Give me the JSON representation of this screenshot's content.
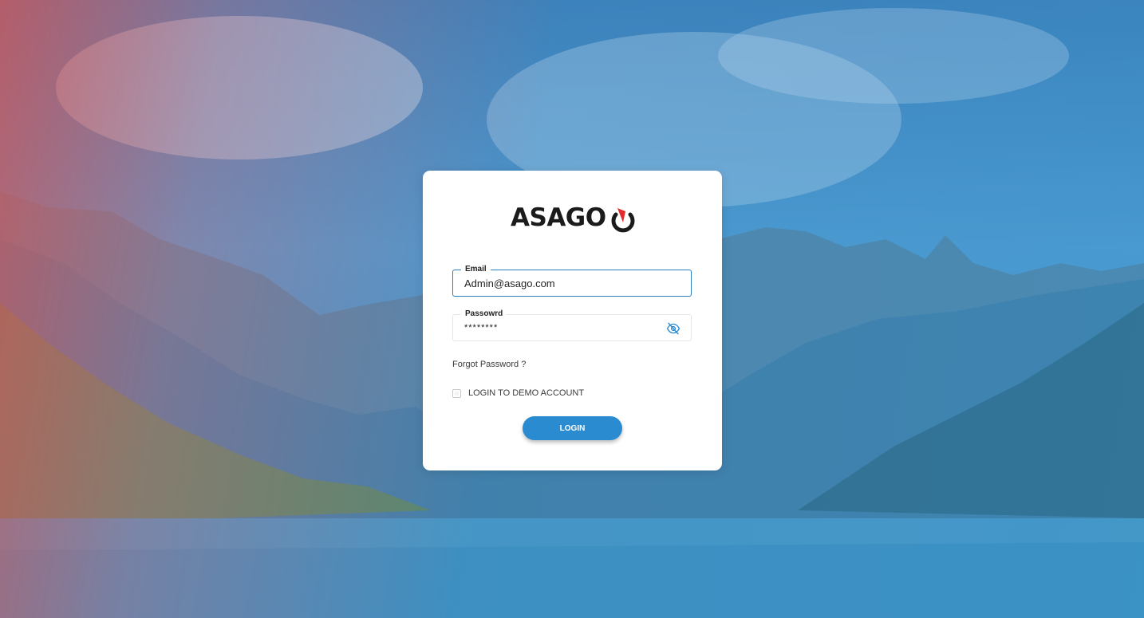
{
  "brand": {
    "logo_text": "ASAGO",
    "logo_icon": "power-timer-icon",
    "accent_color": "#e52b2b"
  },
  "form": {
    "email": {
      "label": "Email",
      "value": "Admin@asago.com"
    },
    "password": {
      "label": "Passowrd",
      "value": "********",
      "toggle_icon": "eye-off-icon"
    },
    "forgot_link": "Forgot Password ?",
    "demo_checkbox_label": "LOGIN TO DEMO ACCOUNT",
    "demo_checked": false,
    "login_button": "LOGIN"
  },
  "colors": {
    "primary": "#2a8bd0",
    "field_focus": "#2d7fc0"
  }
}
